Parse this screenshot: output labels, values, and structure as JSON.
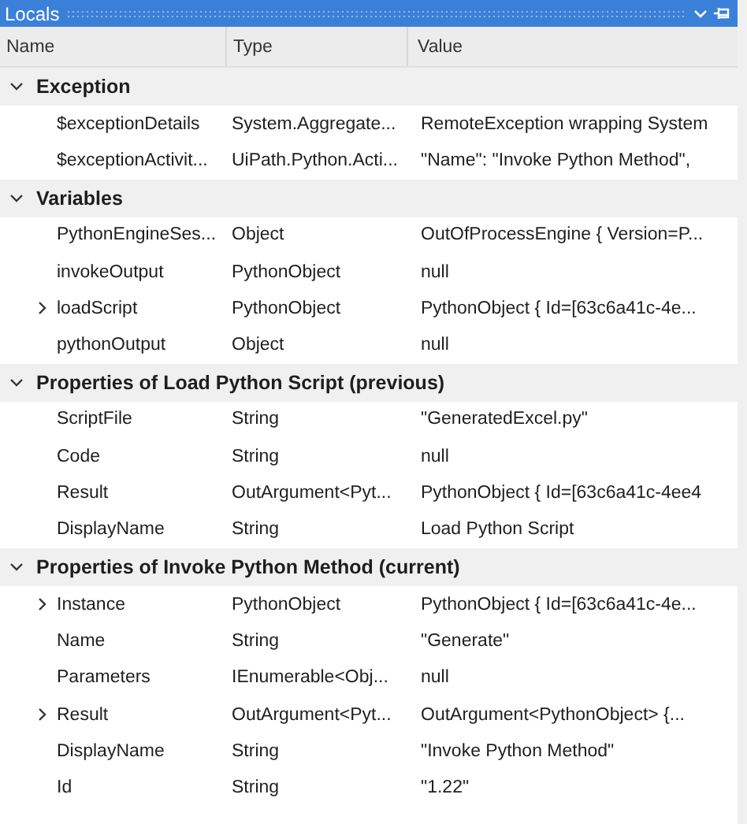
{
  "window": {
    "title": "Locals"
  },
  "columns": [
    "Name",
    "Type",
    "Value"
  ],
  "groups": [
    {
      "title": "Exception",
      "expanded": true,
      "rows": [
        {
          "name": "$exceptionDetails",
          "type": "System.Aggregate...",
          "value": "RemoteException wrapping System",
          "expandable": false
        },
        {
          "name": "$exceptionActivit...",
          "type": "UiPath.Python.Acti...",
          "value": " \"Name\": \"Invoke Python Method\",",
          "expandable": false
        }
      ]
    },
    {
      "title": "Variables",
      "expanded": true,
      "rows": [
        {
          "name": "PythonEngineSes...",
          "type": "Object",
          "value": "OutOfProcessEngine { Version=P...",
          "expandable": false
        },
        {
          "name": "invokeOutput",
          "type": "PythonObject",
          "value": "null",
          "expandable": false
        },
        {
          "name": "loadScript",
          "type": "PythonObject",
          "value": "PythonObject { Id=[63c6a41c-4e...",
          "expandable": true
        },
        {
          "name": "pythonOutput",
          "type": "Object",
          "value": "null",
          "expandable": false
        }
      ]
    },
    {
      "title": "Properties of Load Python Script (previous)",
      "expanded": true,
      "rows": [
        {
          "name": "ScriptFile",
          "type": "String",
          "value": "\"GeneratedExcel.py\"",
          "expandable": false
        },
        {
          "name": "Code",
          "type": "String",
          "value": "null",
          "expandable": false
        },
        {
          "name": "Result",
          "type": "OutArgument<Pyt...",
          "value": "PythonObject { Id=[63c6a41c-4ee4",
          "expandable": false
        },
        {
          "name": "DisplayName",
          "type": "String",
          "value": "Load Python Script",
          "expandable": false
        }
      ]
    },
    {
      "title": "Properties of Invoke Python Method (current)",
      "expanded": true,
      "rows": [
        {
          "name": "Instance",
          "type": "PythonObject",
          "value": "PythonObject { Id=[63c6a41c-4e...",
          "expandable": true
        },
        {
          "name": "Name",
          "type": "String",
          "value": "\"Generate\"",
          "expandable": false
        },
        {
          "name": "Parameters",
          "type": "IEnumerable<Obj...",
          "value": "null",
          "expandable": false
        },
        {
          "name": "Result",
          "type": "OutArgument<Pyt...",
          "value": "OutArgument<PythonObject> {...",
          "expandable": true
        },
        {
          "name": "DisplayName",
          "type": "String",
          "value": "\"Invoke Python Method\"",
          "expandable": false
        },
        {
          "name": "Id",
          "type": "String",
          "value": "\"1.22\"",
          "expandable": false
        }
      ]
    }
  ]
}
